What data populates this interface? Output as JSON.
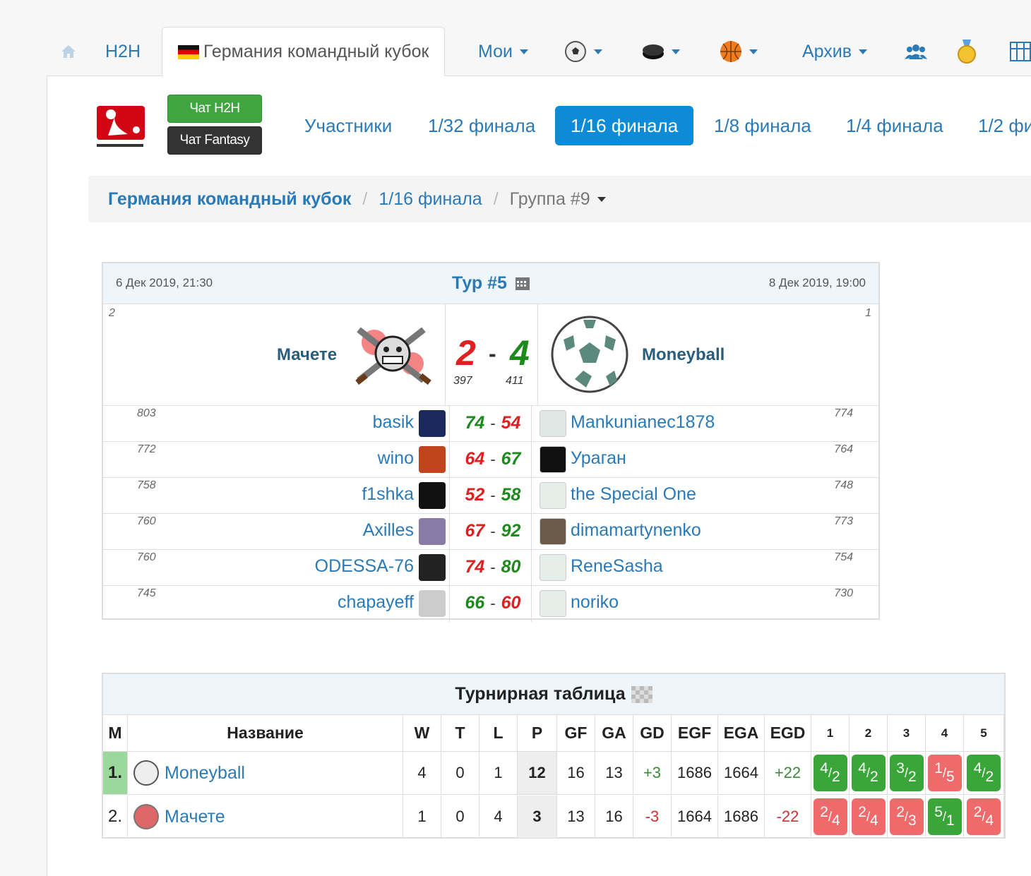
{
  "nav": {
    "home_icon": "home-icon",
    "h2h": "H2H",
    "active_tab": "Германия командный кубок",
    "moi": "Мои",
    "archive": "Архив",
    "icons": [
      "soccer-ball-icon",
      "hockey-puck-icon",
      "basketball-icon",
      "users-icon",
      "medal-icon",
      "scoreboard-icon"
    ]
  },
  "chat": {
    "h2h": "Чат H2H",
    "fantasy": "Чат Fantasy"
  },
  "stages": [
    "Участники",
    "1/32 финала",
    "1/16 финала",
    "1/8 финала",
    "1/4 финала",
    "1/2 фи"
  ],
  "crumb": {
    "cup": "Германия командный кубок",
    "stage": "1/16 финала",
    "group": "Группа #9"
  },
  "match": {
    "date_left": "6 Дек 2019, 21:30",
    "tour": "Тур #5",
    "date_right": "8 Дек 2019, 19:00",
    "pos_left": "2",
    "pos_right": "1",
    "team_left": "Мачете",
    "team_right": "Moneyball",
    "score_left": "2",
    "dash": "-",
    "score_right": "4",
    "pts_left": "397",
    "pts_right": "411",
    "rows": [
      {
        "lr": "803",
        "ln": "basik",
        "ls": "74",
        "rs": "54",
        "rn": "Mankunianec1878",
        "rr": "774",
        "lc": "green",
        "rc": "red"
      },
      {
        "lr": "772",
        "ln": "wino",
        "ls": "64",
        "rs": "67",
        "rn": "Ураган",
        "rr": "764",
        "lc": "red",
        "rc": "green"
      },
      {
        "lr": "758",
        "ln": "f1shka",
        "ls": "52",
        "rs": "58",
        "rn": "the Special One",
        "rr": "748",
        "lc": "red",
        "rc": "green"
      },
      {
        "lr": "760",
        "ln": "Axilles",
        "ls": "67",
        "rs": "92",
        "rn": "dimamartynenko",
        "rr": "773",
        "lc": "red",
        "rc": "green"
      },
      {
        "lr": "760",
        "ln": "ODESSA-76",
        "ls": "74",
        "rs": "80",
        "rn": "ReneSasha",
        "rr": "754",
        "lc": "red",
        "rc": "green"
      },
      {
        "lr": "745",
        "ln": "chapayeff",
        "ls": "66",
        "rs": "60",
        "rn": "noriko",
        "rr": "730",
        "lc": "green",
        "rc": "red"
      }
    ]
  },
  "standings": {
    "title": "Турнирная таблица",
    "headers": [
      "M",
      "Название",
      "W",
      "T",
      "L",
      "P",
      "GF",
      "GA",
      "GD",
      "EGF",
      "EGA",
      "EGD",
      "1",
      "2",
      "3",
      "4",
      "5"
    ],
    "rows": [
      {
        "pos": "1.",
        "name": "Moneyball",
        "w": "4",
        "t": "0",
        "l": "1",
        "p": "12",
        "gf": "16",
        "ga": "13",
        "gd": "+3",
        "egf": "1686",
        "ega": "1664",
        "egd": "+22",
        "res": [
          {
            "a": "4",
            "b": "2",
            "win": true
          },
          {
            "a": "4",
            "b": "2",
            "win": true
          },
          {
            "a": "3",
            "b": "2",
            "win": true
          },
          {
            "a": "1",
            "b": "5",
            "win": false
          },
          {
            "a": "4",
            "b": "2",
            "win": true
          }
        ]
      },
      {
        "pos": "2.",
        "name": "Мачете",
        "w": "1",
        "t": "0",
        "l": "4",
        "p": "3",
        "gf": "13",
        "ga": "16",
        "gd": "-3",
        "egf": "1664",
        "ega": "1686",
        "egd": "-22",
        "res": [
          {
            "a": "2",
            "b": "4",
            "win": false
          },
          {
            "a": "2",
            "b": "4",
            "win": false
          },
          {
            "a": "2",
            "b": "3",
            "win": false
          },
          {
            "a": "5",
            "b": "1",
            "win": true
          },
          {
            "a": "2",
            "b": "4",
            "win": false
          }
        ]
      }
    ]
  },
  "colors": {
    "win": "#3aa63a",
    "loss": "#ef6a6a",
    "link": "#2a7ab8",
    "active": "#0d8bd6"
  }
}
